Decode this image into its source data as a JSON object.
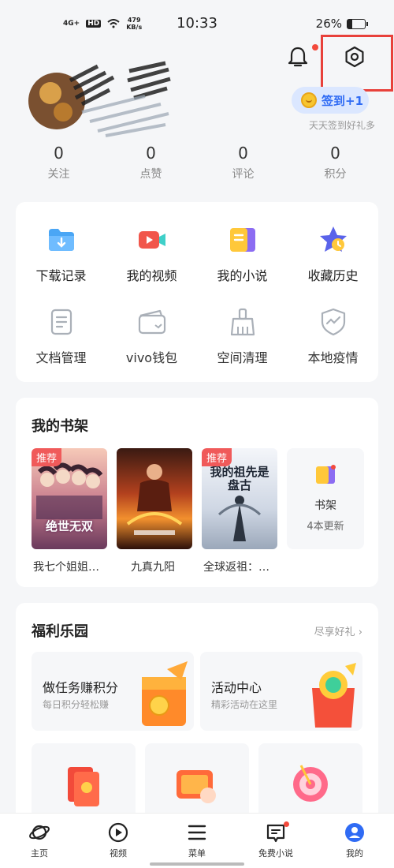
{
  "status_bar": {
    "network": "4G+",
    "hd": "HD",
    "speed_value": "479",
    "speed_unit": "KB/s",
    "time": "10:33",
    "battery": "26%",
    "battery_level": 0.26
  },
  "header": {
    "checkin_label": "签到+1",
    "checkin_subtitle": "天天签到好礼多"
  },
  "stats": [
    {
      "value": "0",
      "label": "关注"
    },
    {
      "value": "0",
      "label": "点赞"
    },
    {
      "value": "0",
      "label": "评论"
    },
    {
      "value": "0",
      "label": "积分"
    }
  ],
  "tools": [
    {
      "label": "下载记录",
      "icon": "download-folder-icon"
    },
    {
      "label": "我的视频",
      "icon": "video-camera-icon"
    },
    {
      "label": "我的小说",
      "icon": "book-icon"
    },
    {
      "label": "收藏历史",
      "icon": "star-clock-icon"
    },
    {
      "label": "文档管理",
      "icon": "document-icon"
    },
    {
      "label": "vivo钱包",
      "icon": "wallet-icon"
    },
    {
      "label": "空间清理",
      "icon": "broom-icon"
    },
    {
      "label": "本地疫情",
      "icon": "shield-icon"
    }
  ],
  "bookshelf": {
    "title": "我的书架",
    "books": [
      {
        "title": "我七个姐姐…",
        "badge": "推荐",
        "cover_text": "绝世无双"
      },
      {
        "title": "九真九阳",
        "badge": "",
        "cover_text": ""
      },
      {
        "title": "全球返祖：…",
        "badge": "推荐",
        "cover_text": "我的祖先是盘古"
      }
    ],
    "shelf_label": "书架",
    "shelf_update": "4本更新"
  },
  "welfare": {
    "title": "福利乐园",
    "more": "尽享好礼",
    "promos": [
      {
        "title": "做任务赚积分",
        "subtitle": "每日积分轻松赚"
      },
      {
        "title": "活动中心",
        "subtitle": "精彩活动在这里"
      }
    ]
  },
  "bottom_nav": [
    {
      "label": "主页",
      "icon": "planet-icon"
    },
    {
      "label": "视频",
      "icon": "play-circle-icon"
    },
    {
      "label": "菜单",
      "icon": "menu-icon"
    },
    {
      "label": "免费小说",
      "icon": "novel-icon"
    },
    {
      "label": "我的",
      "icon": "profile-icon"
    }
  ],
  "colors": {
    "accent_blue": "#2f6bf4",
    "badge_red": "#f05a5a",
    "highlight_red": "#e8413b"
  }
}
